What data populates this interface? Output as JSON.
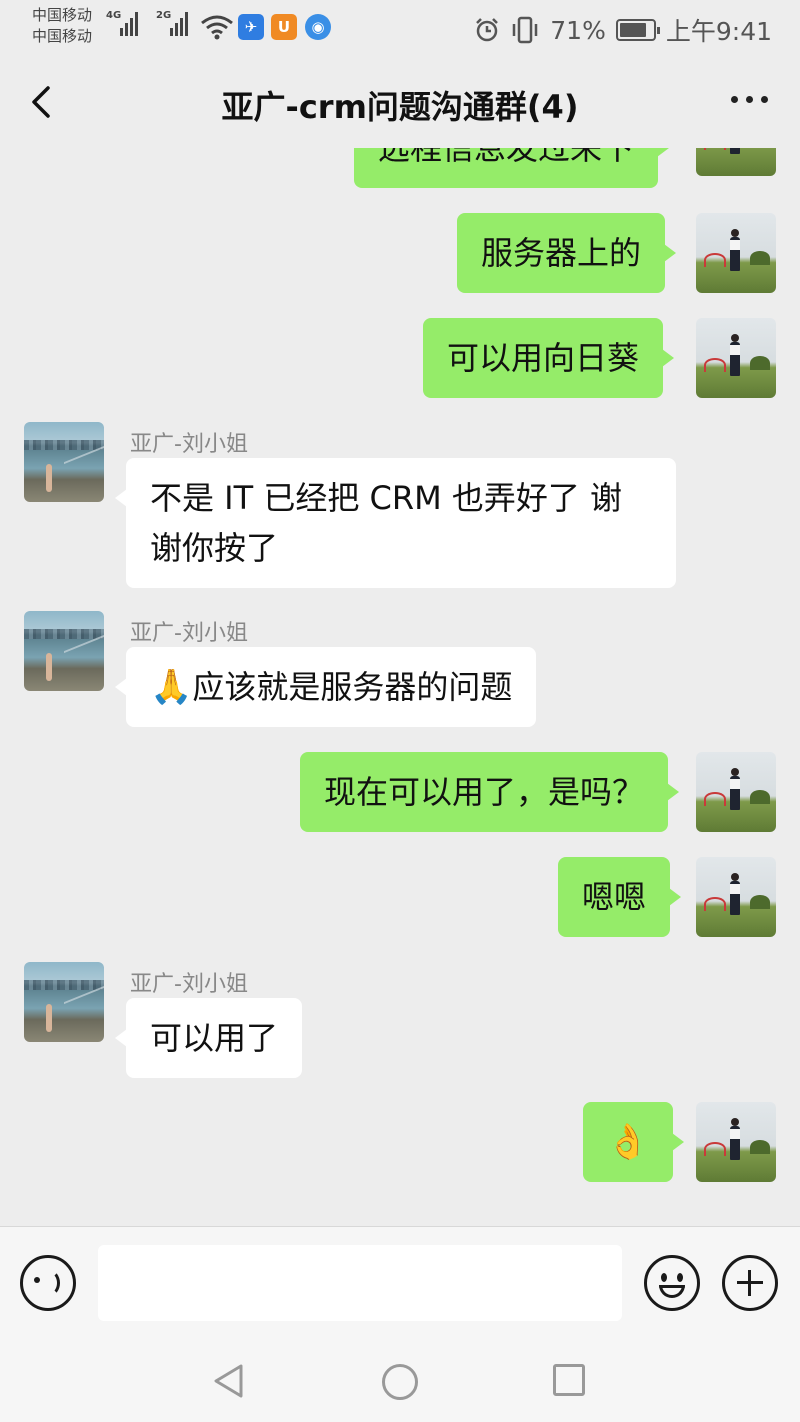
{
  "status_bar": {
    "carrier1": "中国移动",
    "carrier2": "中国移动",
    "net1": "4G",
    "net2": "2G",
    "battery": "71%",
    "time": "上午9:41"
  },
  "nav": {
    "title": "亚广-crm问题沟通群(4)"
  },
  "messages": [
    {
      "side": "me",
      "text": "远程信息发过来下"
    },
    {
      "side": "me",
      "text": "服务器上的"
    },
    {
      "side": "me",
      "text": "可以用向日葵"
    },
    {
      "side": "her",
      "sender": "亚广-刘小姐",
      "text": "不是 IT 已经把 CRM 也弄好了 谢谢你按了"
    },
    {
      "side": "her",
      "sender": "亚广-刘小姐",
      "emoji": "🙏",
      "text": "应该就是服务器的问题"
    },
    {
      "side": "me",
      "text": "现在可以用了，是吗？"
    },
    {
      "side": "me",
      "text": "嗯嗯"
    },
    {
      "side": "her",
      "sender": "亚广-刘小姐",
      "text": "可以用了"
    },
    {
      "side": "me",
      "emoji": "👌"
    }
  ],
  "input": {
    "value": ""
  },
  "colors": {
    "background": "#ededed",
    "bubble_self": "#95ec69",
    "bubble_other": "#ffffff",
    "sender_name": "#888888"
  },
  "icons": [
    "signal-icon",
    "wifi-icon",
    "alarm-icon",
    "vibrate-icon",
    "battery-icon",
    "back-icon",
    "more-icon",
    "voice-icon",
    "emoji-icon",
    "plus-icon",
    "nav-back-icon",
    "nav-home-icon",
    "nav-recent-icon"
  ]
}
